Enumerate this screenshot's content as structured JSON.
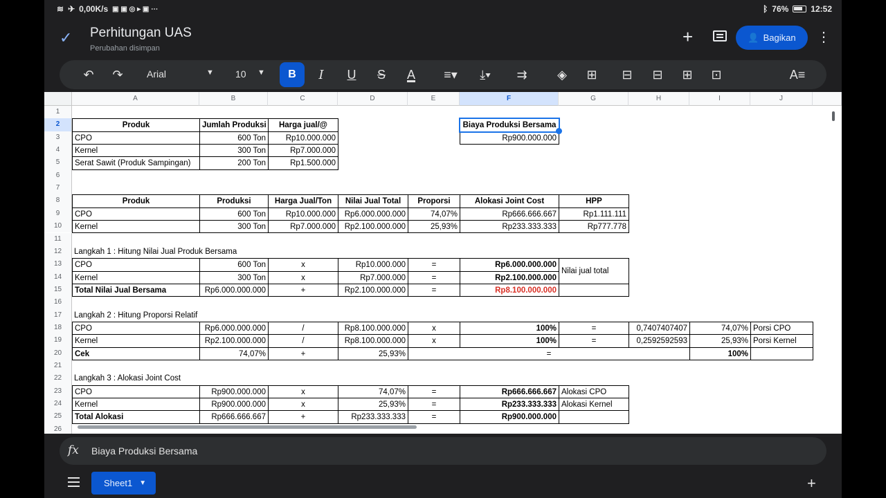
{
  "status": {
    "speed": "0,00K/s",
    "battery": "76%",
    "time": "12:52"
  },
  "doc": {
    "title": "Perhitungan UAS",
    "subtitle": "Perubahan disimpan",
    "share_label": "Bagikan"
  },
  "toolbar": {
    "font": "Arial",
    "font_size": "10",
    "bold": "B",
    "italic": "I",
    "underline": "U",
    "strike": "S",
    "text_color": "A"
  },
  "formula_bar": {
    "fx": "fx",
    "content": "Biaya Produksi Bersama"
  },
  "sheet": {
    "columns": [
      "A",
      "B",
      "C",
      "D",
      "E",
      "F",
      "G",
      "H",
      "I",
      "J"
    ],
    "rows": [
      "1",
      "2",
      "3",
      "4",
      "5",
      "6",
      "7",
      "8",
      "9",
      "10",
      "11",
      "12",
      "13",
      "14",
      "15",
      "16",
      "17",
      "18",
      "19",
      "20",
      "21",
      "22",
      "23",
      "24",
      "25",
      "26"
    ],
    "selected_col": "F",
    "selected_row": "2",
    "t1": {
      "h_produk": "Produk",
      "h_jumlah": "Jumlah Produksi",
      "h_harga": "Harga jual/@",
      "r3a": "CPO",
      "r3b": "600 Ton",
      "r3c": "Rp10.000.000",
      "r4a": "Kernel",
      "r4b": "300 Ton",
      "r4c": "Rp7.000.000",
      "r5a": "Serat Sawit (Produk Sampingan)",
      "r5b": "200 Ton",
      "r5c": "Rp1.500.000",
      "f2": "Biaya Produksi Bersama",
      "f3": "Rp900.000.000"
    },
    "t2": {
      "h_a": "Produk",
      "h_b": "Produksi",
      "h_c": "Harga Jual/Ton",
      "h_d": "Nilai Jual Total",
      "h_e": "Proporsi",
      "h_f": "Alokasi Joint Cost",
      "h_g": "HPP",
      "r9a": "CPO",
      "r9b": "600 Ton",
      "r9c": "Rp10.000.000",
      "r9d": "Rp6.000.000.000",
      "r9e": "74,07%",
      "r9f": "Rp666.666.667",
      "r9g": "Rp1.111.111",
      "r10a": "Kernel",
      "r10b": "300 Ton",
      "r10c": "Rp7.000.000",
      "r10d": "Rp2.100.000.000",
      "r10e": "25,93%",
      "r10f": "Rp233.333.333",
      "r10g": "Rp777.778"
    },
    "step1": {
      "title": "Langkah 1 : Hitung Nilai Jual Produk Bersama",
      "r13a": "CPO",
      "r13b": "600 Ton",
      "r13c": "x",
      "r13d": "Rp10.000.000",
      "r13e": "=",
      "r13f": "Rp6.000.000.000",
      "r14a": "Kernel",
      "r14b": "300 Ton",
      "r14c": "x",
      "r14d": "Rp7.000.000",
      "r14e": "=",
      "r14f": "Rp2.100.000.000",
      "r15a": "Total Nilai Jual Bersama",
      "r15b": "Rp6.000.000.000",
      "r15c": "+",
      "r15d": "Rp2.100.000.000",
      "r15e": "=",
      "r15f": "Rp8.100.000.000",
      "note": "Nilai jual total"
    },
    "step2": {
      "title": "Langkah 2 : Hitung Proporsi Relatif",
      "r18a": "CPO",
      "r18b": "Rp6.000.000.000",
      "r18c": "/",
      "r18d": "Rp8.100.000.000",
      "r18e": "x",
      "r18f": "100%",
      "r18g": "=",
      "r18h": "0,7407407407",
      "r18i": "74,07%",
      "r18j": "Porsi CPO",
      "r19a": "Kernel",
      "r19b": "Rp2.100.000.000",
      "r19c": "/",
      "r19d": "Rp8.100.000.000",
      "r19e": "x",
      "r19f": "100%",
      "r19g": "=",
      "r19h": "0,2592592593",
      "r19i": "25,93%",
      "r19j": "Porsi Kernel",
      "r20a": "Cek",
      "r20b": "74,07%",
      "r20c": "+",
      "r20d": "25,93%",
      "r20eq": "=",
      "r20i": "100%"
    },
    "step3": {
      "title": "Langkah 3 : Alokasi Joint Cost",
      "r23a": "CPO",
      "r23b": "Rp900.000.000",
      "r23c": "x",
      "r23d": "74,07%",
      "r23e": "=",
      "r23f": "Rp666.666.667",
      "r23g": "Alokasi CPO",
      "r24a": "Kernel",
      "r24b": "Rp900.000.000",
      "r24c": "x",
      "r24d": "25,93%",
      "r24e": "=",
      "r24f": "Rp233.333.333",
      "r24g": "Alokasi Kernel",
      "r25a": "Total Alokasi",
      "r25b": "Rp666.666.667",
      "r25c": "+",
      "r25d": "Rp233.333.333",
      "r25e": "=",
      "r25f": "Rp900.000.000"
    }
  },
  "bottom": {
    "sheet_tab": "Sheet1"
  }
}
